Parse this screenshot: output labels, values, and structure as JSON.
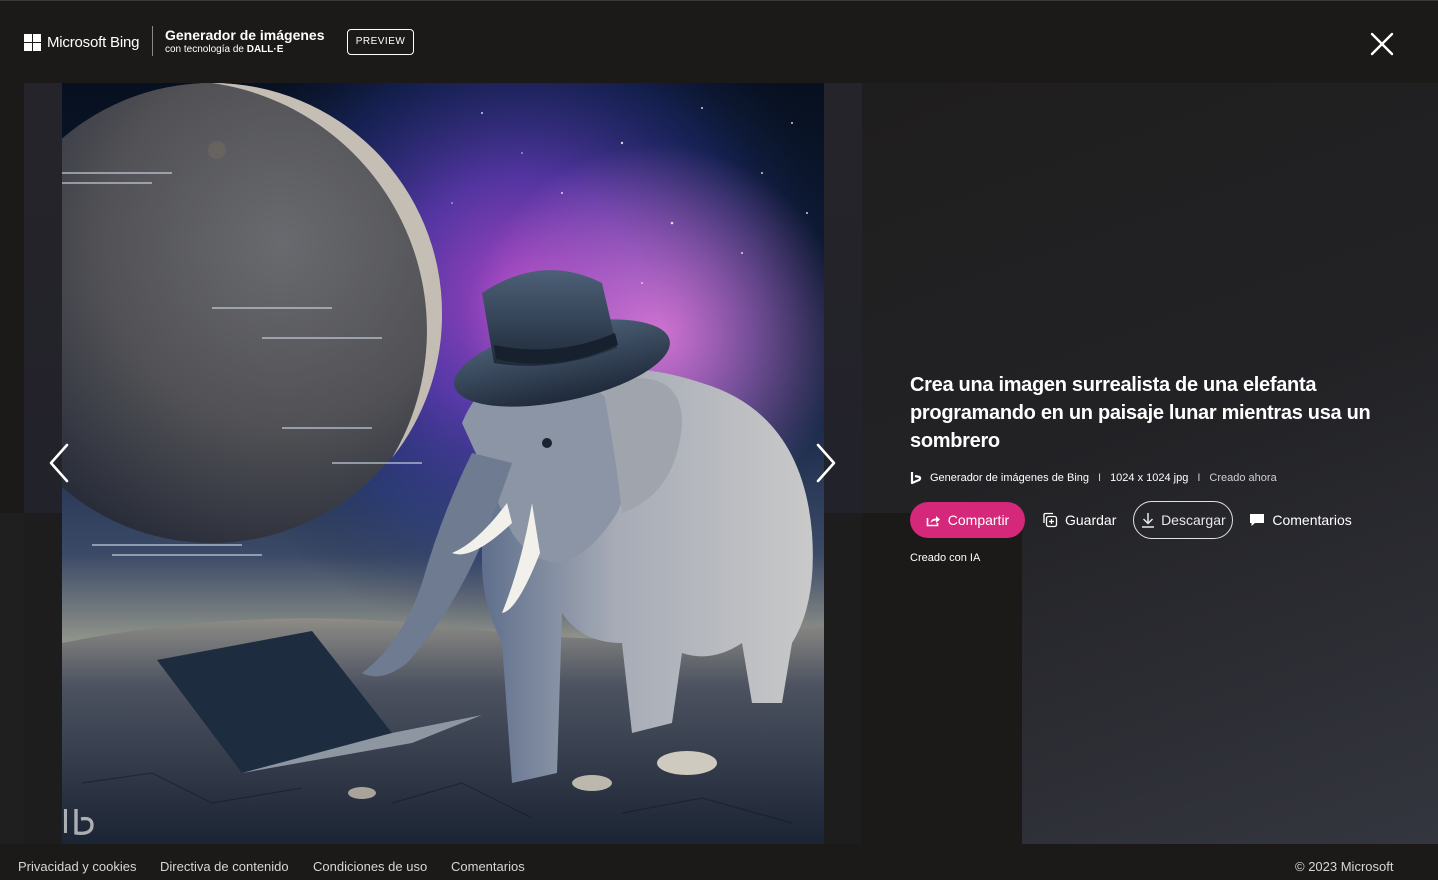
{
  "header": {
    "brand": "Microsoft Bing",
    "product_title": "Generador de imágenes",
    "product_subtitle_prefix": "con tecnología de",
    "product_subtitle_tech": "DALL·E",
    "badge": "PREVIEW",
    "close_icon": "close-icon"
  },
  "viewer": {
    "prev_icon": "chevron-left-icon",
    "next_icon": "chevron-right-icon",
    "image_description_icon": "generated-image"
  },
  "details": {
    "prompt": "Crea una imagen surrealista de una elefanta programando en un paisaje lunar mientras usa un sombrero",
    "source": "Generador de imágenes de Bing",
    "separator": "I",
    "dimensions": "1024 x 1024 jpg",
    "created": "Creado ahora",
    "ai_note": "Creado con IA"
  },
  "actions": {
    "share": "Compartir",
    "save": "Guardar",
    "download": "Descargar",
    "comments": "Comentarios"
  },
  "footer": {
    "links": [
      "Privacidad y cookies",
      "Directiva de contenido",
      "Condiciones de uso",
      "Comentarios"
    ],
    "copyright": "© 2023 Microsoft"
  },
  "colors": {
    "background": "#1b1a19",
    "accent_pink": "#d5287a",
    "text": "#ffffff"
  }
}
